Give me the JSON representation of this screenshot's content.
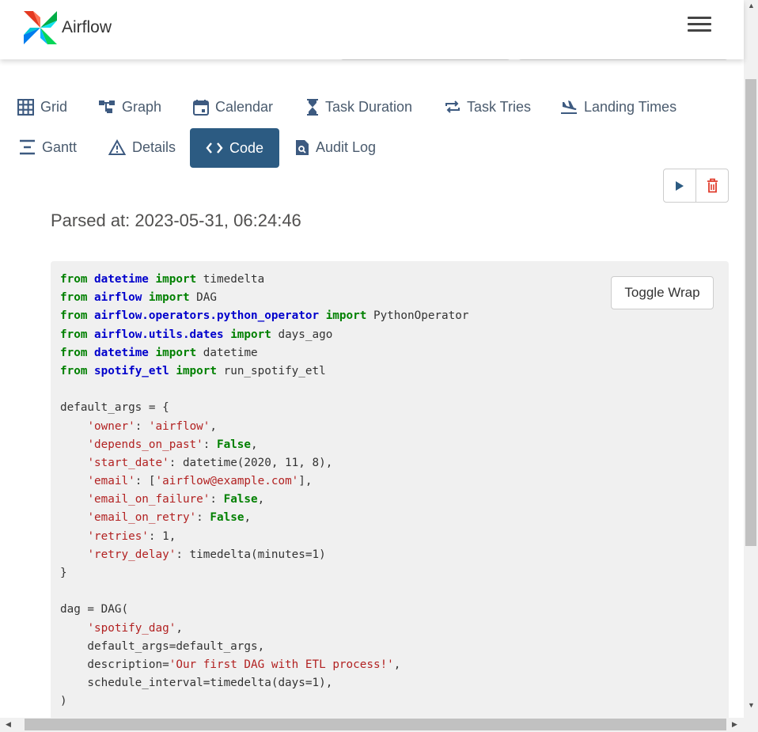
{
  "header": {
    "brand": "Airflow"
  },
  "tabs": [
    {
      "label": "Grid",
      "icon": "grid-icon"
    },
    {
      "label": "Graph",
      "icon": "graph-icon"
    },
    {
      "label": "Calendar",
      "icon": "calendar-icon"
    },
    {
      "label": "Task Duration",
      "icon": "hourglass-icon"
    },
    {
      "label": "Task Tries",
      "icon": "repeat-icon"
    },
    {
      "label": "Landing Times",
      "icon": "landing-icon"
    },
    {
      "label": "Gantt",
      "icon": "gantt-icon"
    },
    {
      "label": "Details",
      "icon": "warning-icon"
    },
    {
      "label": "Code",
      "icon": "code-icon",
      "active": true
    },
    {
      "label": "Audit Log",
      "icon": "audit-icon"
    }
  ],
  "parsed_at": "Parsed at: 2023-05-31, 06:24:46",
  "toggle_wrap": "Toggle Wrap",
  "colors": {
    "accent": "#2c5b82",
    "delete": "#e03b2b"
  },
  "code": [
    [
      [
        "k",
        "from"
      ],
      [
        "t",
        " "
      ],
      [
        "m",
        "datetime"
      ],
      [
        "t",
        " "
      ],
      [
        "k",
        "import"
      ],
      [
        "t",
        " timedelta"
      ]
    ],
    [
      [
        "k",
        "from"
      ],
      [
        "t",
        " "
      ],
      [
        "m",
        "airflow"
      ],
      [
        "t",
        " "
      ],
      [
        "k",
        "import"
      ],
      [
        "t",
        " DAG"
      ]
    ],
    [
      [
        "k",
        "from"
      ],
      [
        "t",
        " "
      ],
      [
        "m",
        "airflow.operators.python_operator"
      ],
      [
        "t",
        " "
      ],
      [
        "k",
        "import"
      ],
      [
        "t",
        " PythonOperator"
      ]
    ],
    [
      [
        "k",
        "from"
      ],
      [
        "t",
        " "
      ],
      [
        "m",
        "airflow.utils.dates"
      ],
      [
        "t",
        " "
      ],
      [
        "k",
        "import"
      ],
      [
        "t",
        " days_ago"
      ]
    ],
    [
      [
        "k",
        "from"
      ],
      [
        "t",
        " "
      ],
      [
        "m",
        "datetime"
      ],
      [
        "t",
        " "
      ],
      [
        "k",
        "import"
      ],
      [
        "t",
        " datetime"
      ]
    ],
    [
      [
        "k",
        "from"
      ],
      [
        "t",
        " "
      ],
      [
        "m",
        "spotify_etl"
      ],
      [
        "t",
        " "
      ],
      [
        "k",
        "import"
      ],
      [
        "t",
        " run_spotify_etl"
      ]
    ],
    [],
    [
      [
        "t",
        "default_args = {"
      ]
    ],
    [
      [
        "t",
        "    "
      ],
      [
        "s",
        "'owner'"
      ],
      [
        "t",
        ": "
      ],
      [
        "s",
        "'airflow'"
      ],
      [
        "t",
        ","
      ]
    ],
    [
      [
        "t",
        "    "
      ],
      [
        "s",
        "'depends_on_past'"
      ],
      [
        "t",
        ": "
      ],
      [
        "k",
        "False"
      ],
      [
        "t",
        ","
      ]
    ],
    [
      [
        "t",
        "    "
      ],
      [
        "s",
        "'start_date'"
      ],
      [
        "t",
        ": datetime(2020, 11, 8),"
      ]
    ],
    [
      [
        "t",
        "    "
      ],
      [
        "s",
        "'email'"
      ],
      [
        "t",
        ": ["
      ],
      [
        "s",
        "'airflow@example.com'"
      ],
      [
        "t",
        "],"
      ]
    ],
    [
      [
        "t",
        "    "
      ],
      [
        "s",
        "'email_on_failure'"
      ],
      [
        "t",
        ": "
      ],
      [
        "k",
        "False"
      ],
      [
        "t",
        ","
      ]
    ],
    [
      [
        "t",
        "    "
      ],
      [
        "s",
        "'email_on_retry'"
      ],
      [
        "t",
        ": "
      ],
      [
        "k",
        "False"
      ],
      [
        "t",
        ","
      ]
    ],
    [
      [
        "t",
        "    "
      ],
      [
        "s",
        "'retries'"
      ],
      [
        "t",
        ": 1,"
      ]
    ],
    [
      [
        "t",
        "    "
      ],
      [
        "s",
        "'retry_delay'"
      ],
      [
        "t",
        ": timedelta(minutes=1)"
      ]
    ],
    [
      [
        "t",
        "}"
      ]
    ],
    [],
    [
      [
        "t",
        "dag = DAG("
      ]
    ],
    [
      [
        "t",
        "    "
      ],
      [
        "s",
        "'spotify_dag'"
      ],
      [
        "t",
        ","
      ]
    ],
    [
      [
        "t",
        "    default_args=default_args,"
      ]
    ],
    [
      [
        "t",
        "    description="
      ],
      [
        "s",
        "'Our first DAG with ETL process!'"
      ],
      [
        "t",
        ","
      ]
    ],
    [
      [
        "t",
        "    schedule_interval=timedelta(days=1),"
      ]
    ],
    [
      [
        "t",
        ")"
      ]
    ]
  ]
}
